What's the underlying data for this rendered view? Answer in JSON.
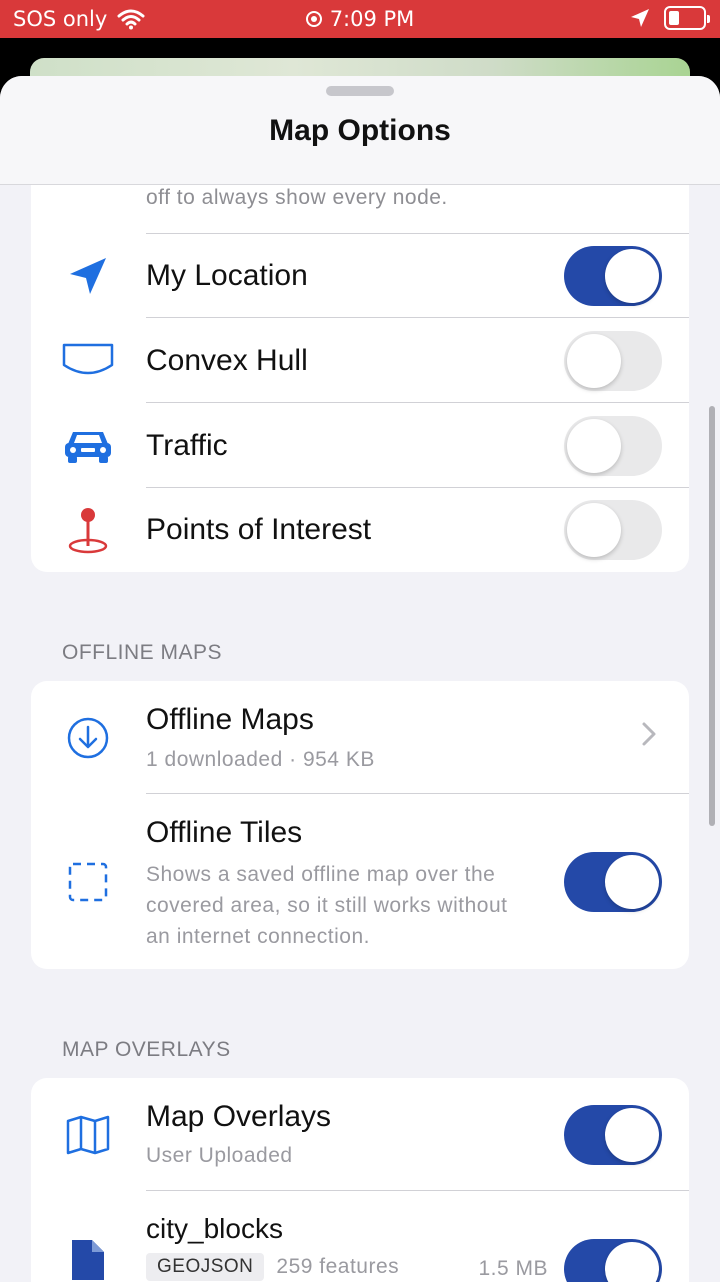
{
  "status": {
    "carrier": "SOS only",
    "time": "7:09 PM"
  },
  "sheet": {
    "title": "Map Options"
  },
  "display_group": {
    "footer_text": "off to always show every node.",
    "rows": [
      {
        "label": "My Location",
        "icon": "location-arrow-icon",
        "on": true
      },
      {
        "label": "Convex Hull",
        "icon": "hull-shape-icon",
        "on": false
      },
      {
        "label": "Traffic",
        "icon": "car-icon",
        "on": false
      },
      {
        "label": "Points of Interest",
        "icon": "map-pin-icon",
        "on": false
      }
    ]
  },
  "offline": {
    "header": "OFFLINE MAPS",
    "maps_label": "Offline Maps",
    "maps_sub": "1 downloaded · 954 KB",
    "tiles_label": "Offline Tiles",
    "tiles_desc_1": "Shows a saved offline map over the",
    "tiles_desc_2": "covered area, so it still works without",
    "tiles_desc_3": "an internet connection.",
    "tiles_on": true
  },
  "overlays": {
    "header": "MAP OVERLAYS",
    "label": "Map Overlays",
    "sub": "User Uploaded",
    "on": true,
    "file_name": "city_blocks",
    "file_type": "GEOJSON",
    "file_features": "259 features",
    "file_size": "1.5 MB",
    "file_on": true
  },
  "colors": {
    "status_bar": "#d9393a",
    "toggle_on": "#2449a8",
    "accent_blue": "#1f6fe0",
    "pin_red": "#d9393a"
  }
}
